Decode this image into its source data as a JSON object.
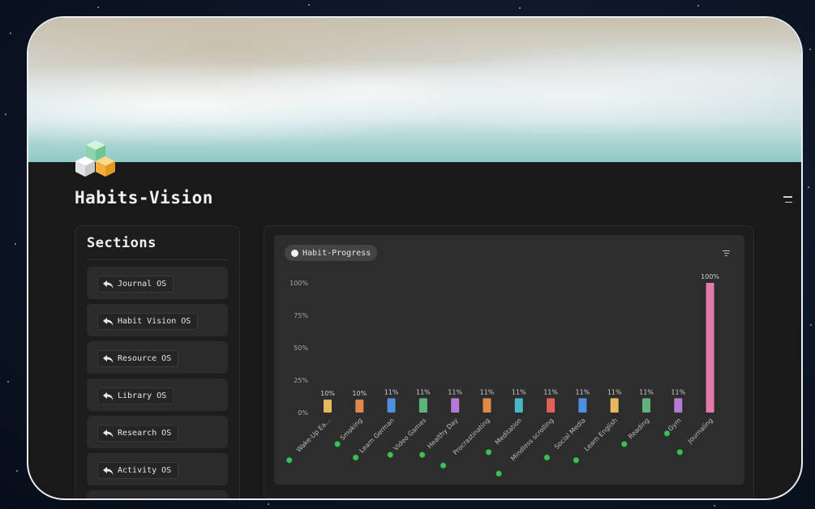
{
  "page": {
    "title": "Habits-Vision",
    "icon": "cubes-icon",
    "cover": "ocean-waves-cover-image"
  },
  "sections": {
    "title": "Sections",
    "items": [
      {
        "label": "Journal OS",
        "icon": "back-arrow-icon"
      },
      {
        "label": "Habit Vision OS",
        "icon": "back-arrow-icon"
      },
      {
        "label": "Resource OS",
        "icon": "back-arrow-icon"
      },
      {
        "label": "Library OS",
        "icon": "back-arrow-icon"
      },
      {
        "label": "Research OS",
        "icon": "back-arrow-icon"
      },
      {
        "label": "Activity OS",
        "icon": "back-arrow-icon"
      }
    ]
  },
  "chart_view": {
    "label": "Habit-Progress",
    "filter_icon": "filter-icon"
  },
  "chart_data": {
    "type": "bar",
    "categories": [
      "Wake-Up Ea...",
      "Smoking",
      "Learn German",
      "Video Games",
      "Healthy Day",
      "Procrastinating",
      "Meditation",
      "Mindless scrolling",
      "Social Media",
      "Learn English",
      "Reading",
      "Gym",
      "Journaling"
    ],
    "values": [
      10,
      10,
      11,
      11,
      11,
      11,
      11,
      11,
      11,
      11,
      11,
      11,
      100
    ],
    "data_labels": [
      "10%",
      "10%",
      "11%",
      "11%",
      "11%",
      "11%",
      "11%",
      "11%",
      "11%",
      "11%",
      "11%",
      "11%",
      "100%"
    ],
    "colors": [
      "#e8b85c",
      "#e0894a",
      "#4f8fe0",
      "#5fb37a",
      "#b57ad6",
      "#e0894a",
      "#46b7c6",
      "#e0615a",
      "#4f8fe0",
      "#e8b85c",
      "#5fb37a",
      "#b57ad6",
      "#e07aa8"
    ],
    "y_ticks": [
      "0%",
      "25%",
      "50%",
      "75%",
      "100%"
    ],
    "y_tick_values": [
      0,
      25,
      50,
      75,
      100
    ],
    "ylim": [
      0,
      100
    ],
    "grid": false,
    "category_badge": "green-check-icon"
  }
}
